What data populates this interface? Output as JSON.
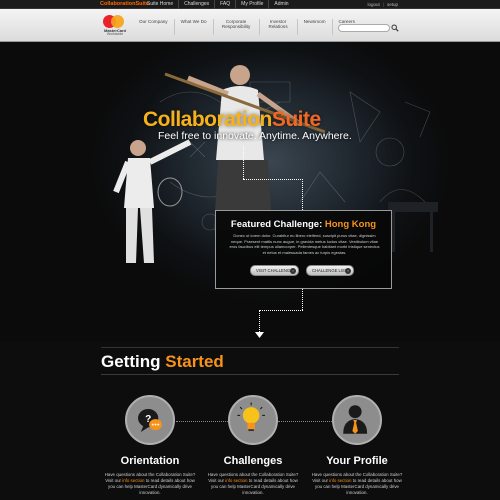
{
  "topbar": {
    "brand_main": "Collaboration",
    "brand_accent": "Suite",
    "nav": [
      "Suite Home",
      "Challenges",
      "FAQ",
      "My Profile",
      "Admin"
    ],
    "right": [
      "logout",
      "setup"
    ]
  },
  "header": {
    "logo_name": "MasterCard",
    "logo_sub": "Worldwide",
    "nav": [
      "Our Company",
      "What We Do",
      "Corporate Responsibility",
      "Investor Relations",
      "Newsroom",
      "Careers"
    ],
    "search_placeholder": ""
  },
  "hero": {
    "title_main": "Collaboration",
    "title_accent": "Suite",
    "subtitle": "Feel free to innovate.  Anytime.  Anywhere."
  },
  "featured": {
    "heading_main": "Featured Challenge:",
    "heading_accent": "Hong Kong",
    "body": "Donec ut lorem dolor. Curabitur eu libero eleifend, suscipit purus vitae, dignissim neque. Praesent mattis nunc augue, in gravida metus luctus vitae. Vestibulum vitae eros faucibus elit tempus ullamcorper. Pellentesque habitant morbi tristique senectus et netus et malesuada fames ac turpis egestas.",
    "visit_button": "VISIT CHALLENGE",
    "list_button": "CHALLENGE LIST"
  },
  "getting_started": {
    "title_main": "Getting",
    "title_accent": "Started",
    "cards": [
      {
        "label": "Orientation",
        "desc_pre": "Have questions about the Collaboration Suite? Visit our ",
        "desc_link": "info section",
        "desc_post": " to read details about how you can help MasterCard dynamically drive innovation.",
        "icon": "question-bubble-icon"
      },
      {
        "label": "Challenges",
        "desc_pre": "Have questions about the Collaboration Suite? Visit our ",
        "desc_link": "info section",
        "desc_post": " to read details about how you can help MasterCard dynamically drive innovation.",
        "icon": "lightbulb-icon"
      },
      {
        "label": "Your Profile",
        "desc_pre": "Have questions about the Collaboration Suite? Visit our ",
        "desc_link": "info section",
        "desc_post": " to read details about how you can help MasterCard dynamically drive innovation.",
        "icon": "person-tie-icon"
      }
    ]
  },
  "colors": {
    "accent_orange": "#f7931a",
    "accent_red_orange": "#f26722",
    "mastercard_red": "#e8212a",
    "mastercard_yellow": "#f8a21a"
  }
}
